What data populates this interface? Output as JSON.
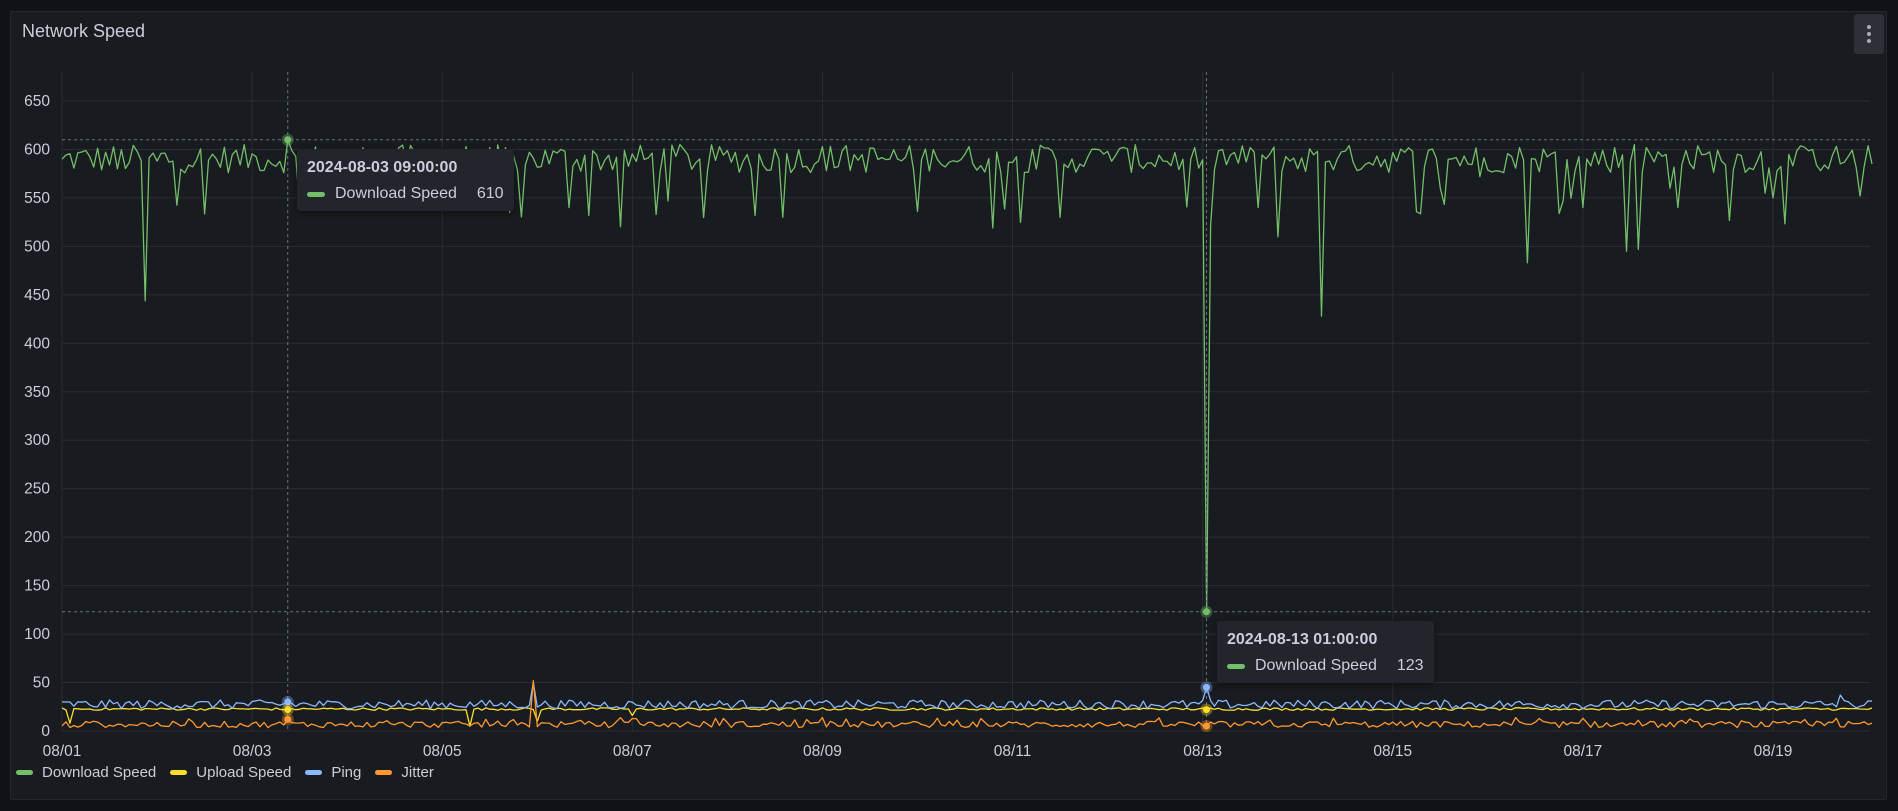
{
  "panel": {
    "title": "Network Speed",
    "menu_icon": "kebab-vertical-icon"
  },
  "tooltips": [
    {
      "time": "2024-08-03 09:00:00",
      "series": "Download Speed",
      "value": "610",
      "color": "#73bf69"
    },
    {
      "time": "2024-08-13 01:00:00",
      "series": "Download Speed",
      "value": "123",
      "color": "#73bf69"
    }
  ],
  "chart_data": {
    "type": "line",
    "title": "Network Speed",
    "xlabel": "",
    "ylabel": "",
    "ylim": [
      0,
      650
    ],
    "yticks": [
      "0",
      "50",
      "100",
      "150",
      "200",
      "250",
      "300",
      "350",
      "400",
      "450",
      "500",
      "550",
      "600",
      "650"
    ],
    "xticks": [
      "08/01",
      "08/03",
      "08/05",
      "08/07",
      "08/09",
      "08/11",
      "08/13",
      "08/15",
      "08/17",
      "08/19"
    ],
    "x_range_days": [
      0,
      19.05
    ],
    "x_start": "2024-08-01 00:00:00",
    "grid": true,
    "legend_position": "bottom-left",
    "hover_points": [
      {
        "time": "2024-08-03 09:00:00",
        "day": 2.375,
        "download": 610,
        "upload": 22,
        "ping": 30,
        "jitter": 12
      },
      {
        "time": "2024-08-13 01:00:00",
        "day": 12.04,
        "download": 123,
        "upload": 22,
        "ping": 45,
        "jitter": 5
      }
    ],
    "series": [
      {
        "name": "Download Speed",
        "color": "#73bf69",
        "typical_range": [
          560,
          605
        ],
        "notable_points": [
          {
            "day": 0.0,
            "value": 590
          },
          {
            "day": 0.6,
            "value": 580
          },
          {
            "day": 0.88,
            "value": 444
          },
          {
            "day": 1.0,
            "value": 588
          },
          {
            "day": 2.375,
            "value": 610
          },
          {
            "day": 2.9,
            "value": 588
          },
          {
            "day": 4.55,
            "value": 555
          },
          {
            "day": 4.7,
            "value": 535
          },
          {
            "day": 5.35,
            "value": 540
          },
          {
            "day": 5.55,
            "value": 532
          },
          {
            "day": 6.25,
            "value": 533
          },
          {
            "day": 6.5,
            "value": 605
          },
          {
            "day": 7.3,
            "value": 532
          },
          {
            "day": 7.6,
            "value": 530
          },
          {
            "day": 8.0,
            "value": 603
          },
          {
            "day": 9.0,
            "value": 536
          },
          {
            "day": 9.2,
            "value": 590
          },
          {
            "day": 9.8,
            "value": 519
          },
          {
            "day": 10.2,
            "value": 600
          },
          {
            "day": 10.5,
            "value": 530
          },
          {
            "day": 11.0,
            "value": 598
          },
          {
            "day": 11.8,
            "value": 590
          },
          {
            "day": 12.04,
            "value": 123
          },
          {
            "day": 12.2,
            "value": 600
          },
          {
            "day": 12.6,
            "value": 540
          },
          {
            "day": 12.8,
            "value": 510
          },
          {
            "day": 13.0,
            "value": 580
          },
          {
            "day": 13.25,
            "value": 428
          },
          {
            "day": 13.4,
            "value": 590
          },
          {
            "day": 14.5,
            "value": 560
          },
          {
            "day": 14.9,
            "value": 572
          },
          {
            "day": 15.4,
            "value": 483
          },
          {
            "day": 15.5,
            "value": 590
          },
          {
            "day": 16.0,
            "value": 540
          },
          {
            "day": 16.45,
            "value": 495
          },
          {
            "day": 16.55,
            "value": 605
          },
          {
            "day": 16.6,
            "value": 497
          },
          {
            "day": 16.7,
            "value": 595
          },
          {
            "day": 16.9,
            "value": 560
          },
          {
            "day": 17.0,
            "value": 540
          },
          {
            "day": 17.9,
            "value": 555
          },
          {
            "day": 18.0,
            "value": 550
          },
          {
            "day": 18.4,
            "value": 600
          },
          {
            "day": 18.9,
            "value": 552
          },
          {
            "day": 19.05,
            "value": 585
          }
        ]
      },
      {
        "name": "Upload Speed",
        "color": "#fade2a",
        "typical_range": [
          20,
          24
        ],
        "notable_points": [
          {
            "day": 0.1,
            "value": 8
          },
          {
            "day": 2.375,
            "value": 22
          },
          {
            "day": 4.3,
            "value": 5
          },
          {
            "day": 5.0,
            "value": 10
          },
          {
            "day": 6.0,
            "value": 16
          }
        ]
      },
      {
        "name": "Ping",
        "color": "#8ab8ff",
        "typical_range": [
          18,
          32
        ],
        "notable_points": [
          {
            "day": 2.375,
            "value": 30
          },
          {
            "day": 4.95,
            "value": 50
          },
          {
            "day": 12.04,
            "value": 45
          },
          {
            "day": 18.7,
            "value": 37
          }
        ]
      },
      {
        "name": "Jitter",
        "color": "#ff9830",
        "typical_range": [
          0,
          10
        ],
        "notable_points": [
          {
            "day": 2.375,
            "value": 12
          },
          {
            "day": 4.95,
            "value": 52
          },
          {
            "day": 12.04,
            "value": 5
          }
        ]
      }
    ]
  },
  "legend": [
    {
      "label": "Download Speed",
      "color": "#73bf69"
    },
    {
      "label": "Upload Speed",
      "color": "#fade2a"
    },
    {
      "label": "Ping",
      "color": "#8ab8ff"
    },
    {
      "label": "Jitter",
      "color": "#ff9830"
    }
  ]
}
